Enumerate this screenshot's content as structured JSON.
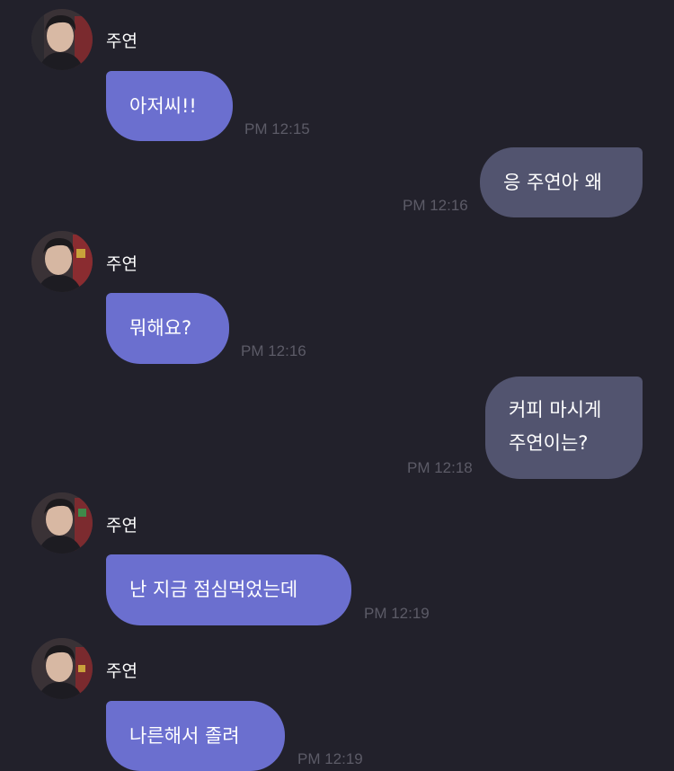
{
  "contact": {
    "name": "주연"
  },
  "colors": {
    "background": "#22212b",
    "incoming_bubble": "#6b6fcf",
    "outgoing_bubble": "#52546f",
    "timestamp": "#5c5b67"
  },
  "messages": [
    {
      "sender": "주연",
      "direction": "incoming",
      "lines": [
        "아저씨!!"
      ],
      "time": "PM 12:15"
    },
    {
      "sender": "me",
      "direction": "outgoing",
      "lines": [
        "응 주연아 왜"
      ],
      "time": "PM 12:16"
    },
    {
      "sender": "주연",
      "direction": "incoming",
      "lines": [
        "뭐해요?"
      ],
      "time": "PM 12:16"
    },
    {
      "sender": "me",
      "direction": "outgoing",
      "lines": [
        "커피 마시게",
        "주연이는?"
      ],
      "time": "PM 12:18"
    },
    {
      "sender": "주연",
      "direction": "incoming",
      "lines": [
        "난 지금 점심먹었는데"
      ],
      "time": "PM 12:19"
    },
    {
      "sender": "주연",
      "direction": "incoming",
      "lines": [
        "나른해서 졸려"
      ],
      "time": "PM 12:19"
    }
  ]
}
